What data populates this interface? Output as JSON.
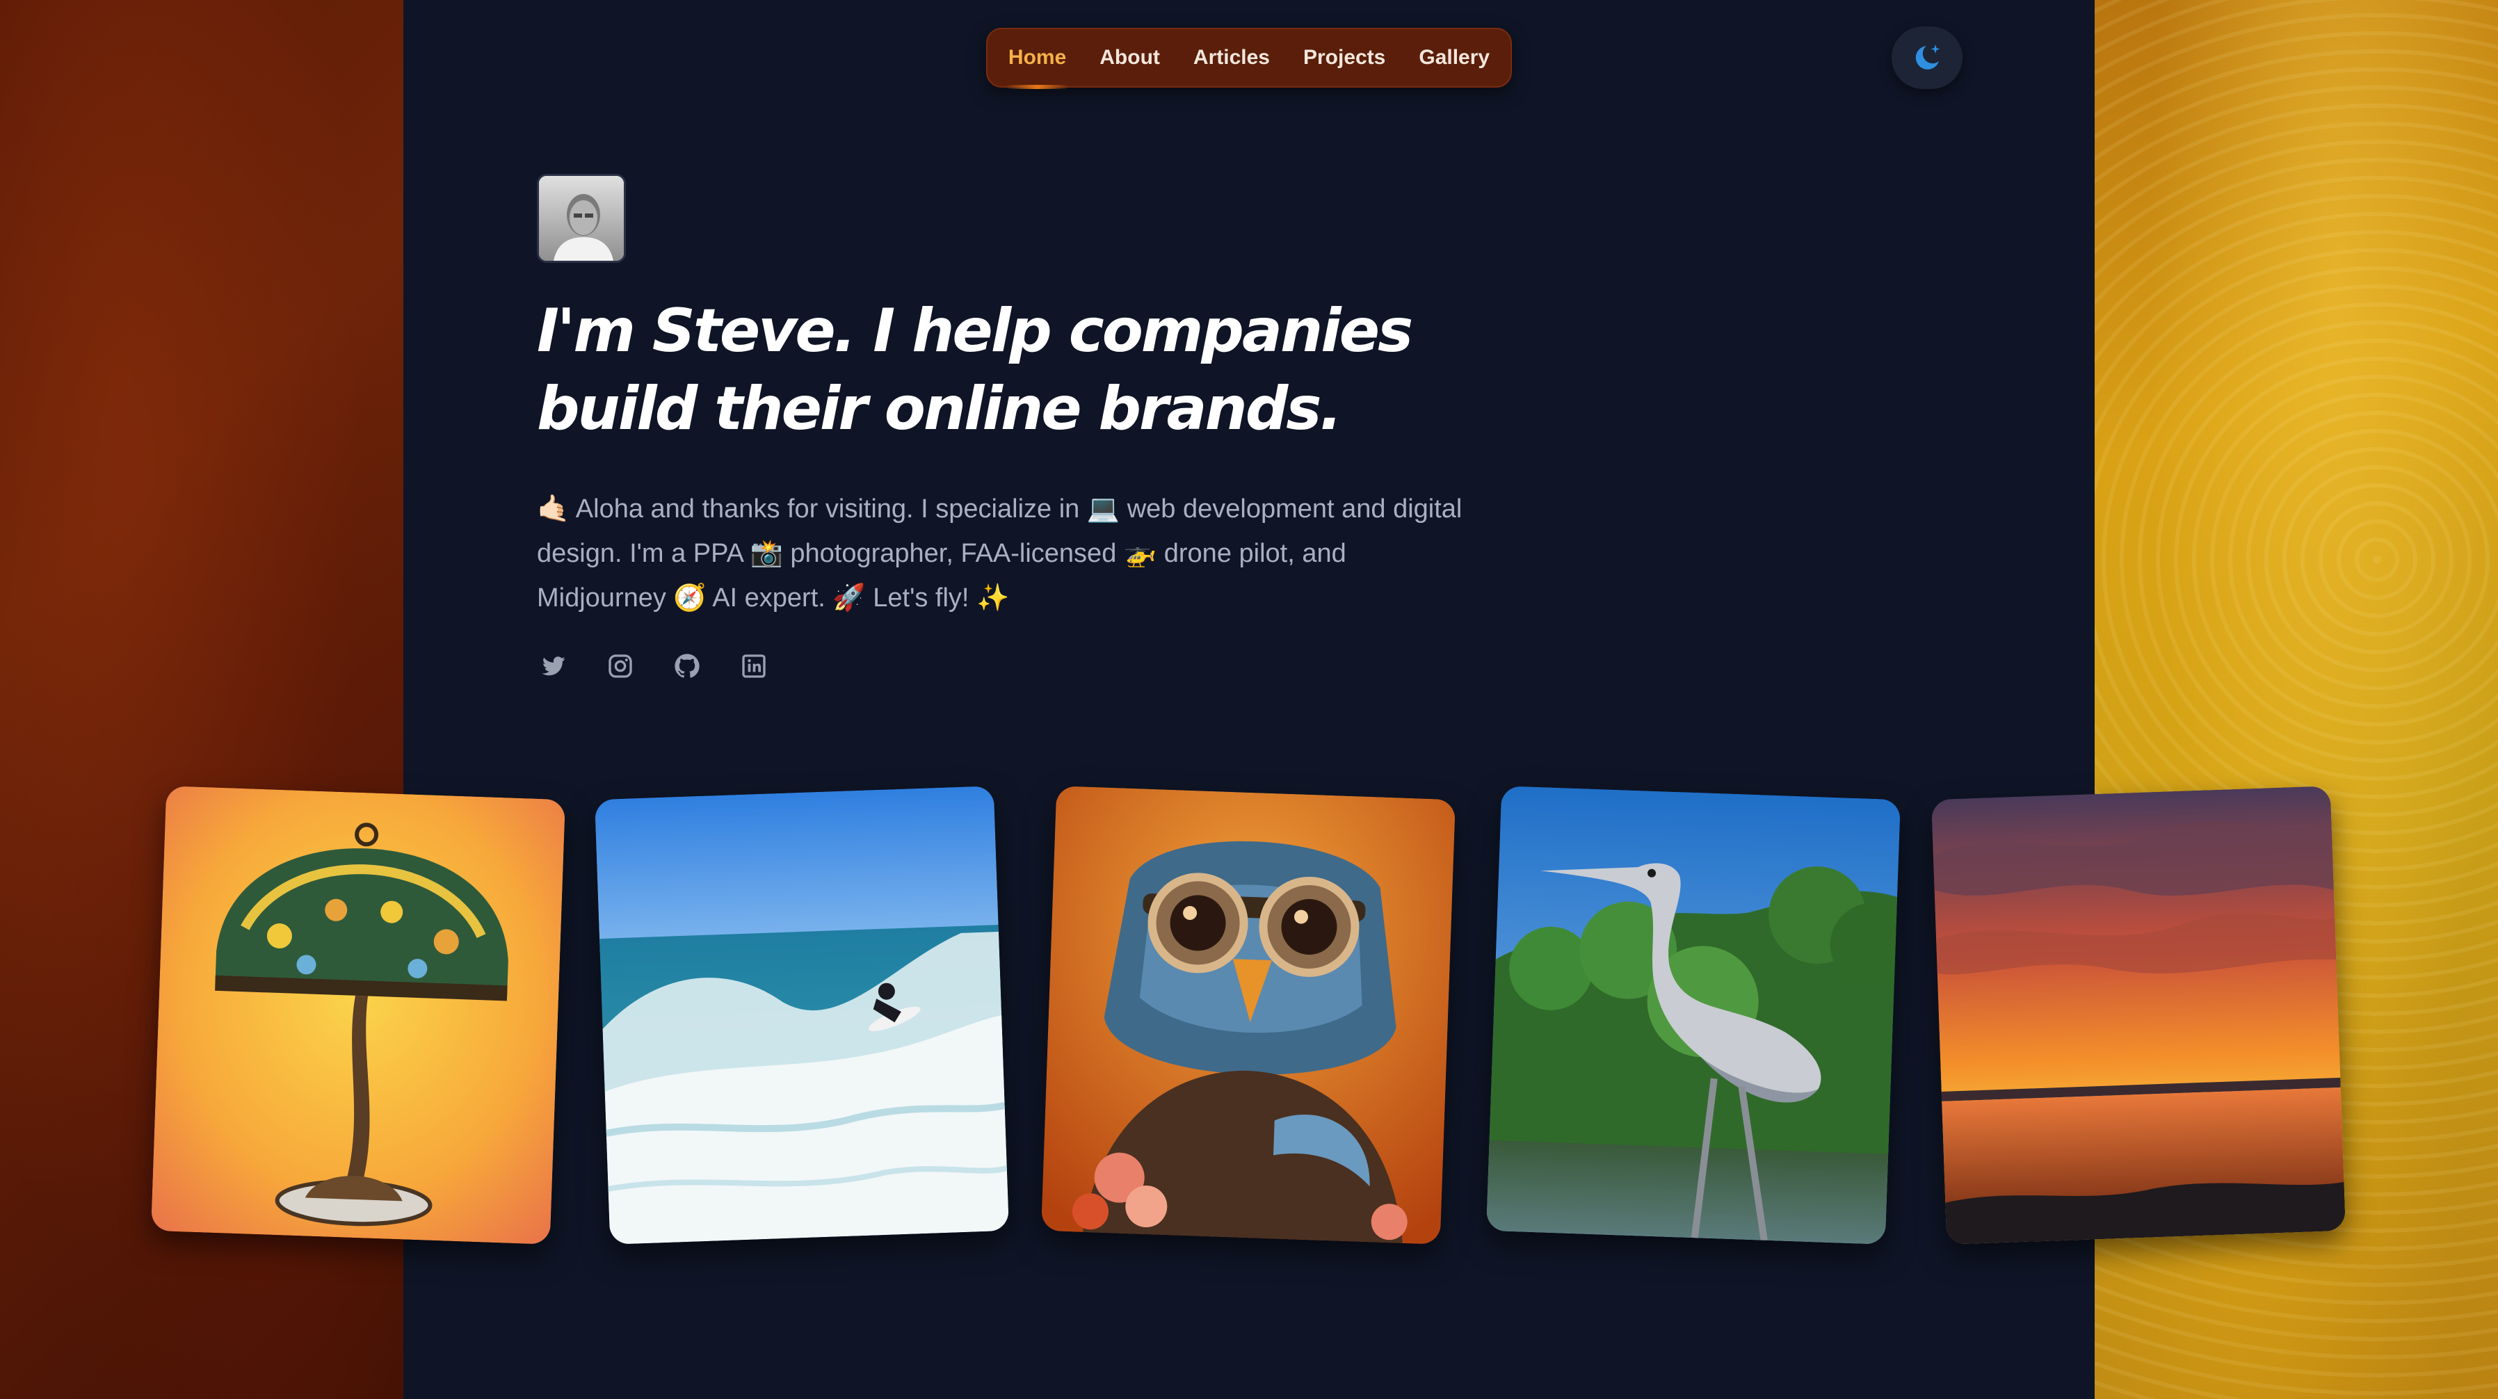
{
  "nav": {
    "items": [
      {
        "label": "Home",
        "active": true
      },
      {
        "label": "About",
        "active": false
      },
      {
        "label": "Articles",
        "active": false
      },
      {
        "label": "Projects",
        "active": false
      },
      {
        "label": "Gallery",
        "active": false
      }
    ]
  },
  "theme_toggle": {
    "icon": "moon-star-icon"
  },
  "hero": {
    "avatar_icon": "avatar-photo",
    "headline": "I'm Steve. I help companies build their online brands.",
    "intro": "🤙🏻 Aloha and thanks for visiting. I specialize in 💻 web development and digital design. I'm a PPA 📸 photographer, FAA-licensed 🚁 drone pilot, and Midjourney 🧭 AI expert. 🚀 Let's fly! ✨"
  },
  "socials": [
    {
      "icon": "twitter-icon"
    },
    {
      "icon": "instagram-icon"
    },
    {
      "icon": "github-icon"
    },
    {
      "icon": "linkedin-icon"
    }
  ],
  "gallery": [
    {
      "icon": "tiffany-lamp-photo"
    },
    {
      "icon": "surfer-wave-photo"
    },
    {
      "icon": "owl-goggles-artwork"
    },
    {
      "icon": "heron-photo"
    },
    {
      "icon": "sunset-river-photo"
    }
  ],
  "colors": {
    "accent": "#f5b04a",
    "background": "#0f1526",
    "text_muted": "#a9b0bf",
    "nav_bg": "#5a1e0a",
    "theme_icon": "#2f8fe0"
  }
}
